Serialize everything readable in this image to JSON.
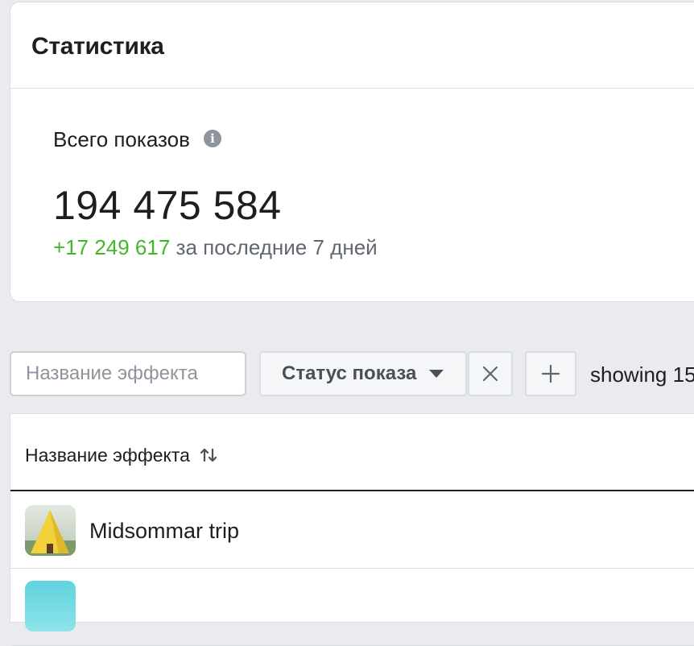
{
  "stats": {
    "title": "Статистика",
    "metric_label": "Всего показов",
    "metric_value": "194 475 584",
    "delta_value": "+17 249 617",
    "delta_suffix": " за последние 7 дней"
  },
  "filters": {
    "search_placeholder": "Название эффекта",
    "status_label": "Статус показа",
    "showing_text": "showing 15"
  },
  "table": {
    "column_name": "Название эффекта",
    "rows": [
      {
        "name": "Midsommar trip"
      },
      {
        "name": ""
      }
    ]
  },
  "colors": {
    "accent_green": "#42b72a",
    "border": "#dadde1",
    "background": "#e9ebee"
  },
  "icons": {
    "info": "info-icon",
    "caret": "caret-down-icon",
    "clear": "close-icon",
    "add": "plus-icon",
    "sort": "sort-icon"
  }
}
